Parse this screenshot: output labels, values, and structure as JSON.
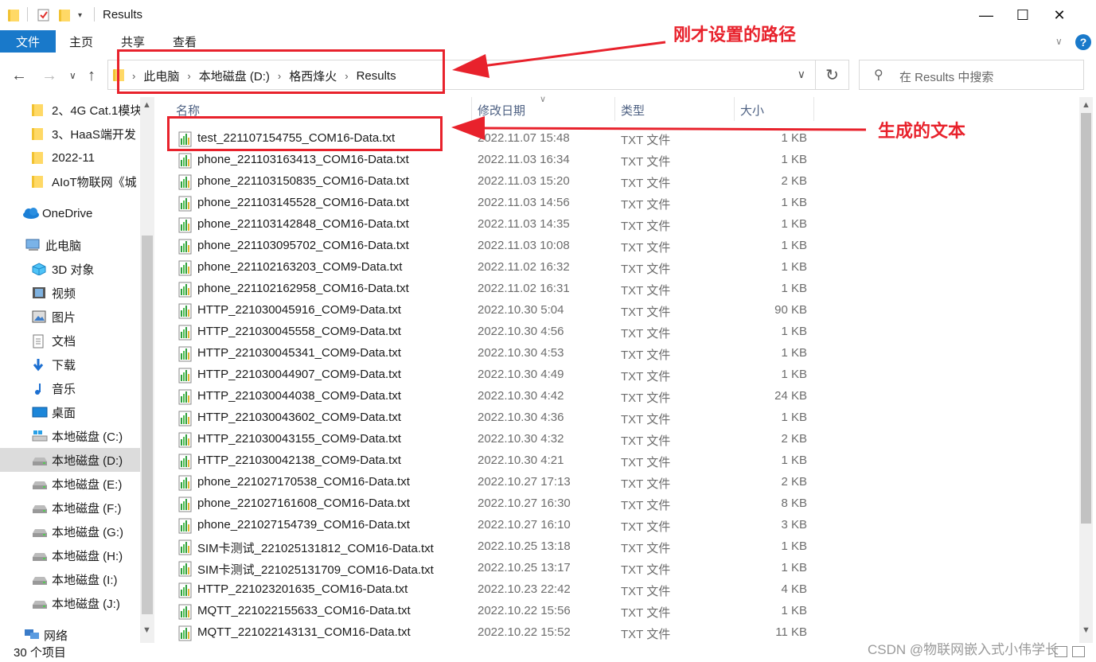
{
  "window": {
    "title": "Results",
    "min_glyph": "—",
    "max_glyph": "☐",
    "close_glyph": "✕"
  },
  "ribbon": {
    "tabs": [
      "文件",
      "主页",
      "共享",
      "查看"
    ],
    "help_glyph": "?",
    "collapse_glyph": "∨"
  },
  "address": {
    "crumbs": [
      "此电脑",
      "本地磁盘 (D:)",
      "格西烽火",
      "Results"
    ],
    "sep": "›",
    "dropdown_glyph": "∨",
    "refresh_glyph": "↻"
  },
  "search": {
    "placeholder": "在 Results 中搜索",
    "icon_glyph": "⚲"
  },
  "nav": {
    "back": "←",
    "forward": "→",
    "recent": "∨",
    "up": "↑"
  },
  "sidebar": {
    "items": [
      {
        "label": "2、4G Cat.1模块",
        "icon": "folder-icon"
      },
      {
        "label": "3、HaaS端开发",
        "icon": "folder-icon"
      },
      {
        "label": "2022-11",
        "icon": "folder-icon"
      },
      {
        "label": "AIoT物联网《城",
        "icon": "folder-icon"
      },
      {
        "label": "OneDrive",
        "icon": "cloud-icon"
      },
      {
        "label": "此电脑",
        "icon": "computer-icon"
      },
      {
        "label": "3D 对象",
        "icon": "cube-icon"
      },
      {
        "label": "视频",
        "icon": "video-icon"
      },
      {
        "label": "图片",
        "icon": "picture-icon"
      },
      {
        "label": "文档",
        "icon": "document-icon"
      },
      {
        "label": "下载",
        "icon": "download-icon"
      },
      {
        "label": "音乐",
        "icon": "music-icon"
      },
      {
        "label": "桌面",
        "icon": "desktop-icon"
      },
      {
        "label": "本地磁盘 (C:)",
        "icon": "windows-drive-icon"
      },
      {
        "label": "本地磁盘 (D:)",
        "icon": "drive-icon",
        "selected": true
      },
      {
        "label": "本地磁盘 (E:)",
        "icon": "drive-icon"
      },
      {
        "label": "本地磁盘 (F:)",
        "icon": "drive-icon"
      },
      {
        "label": "本地磁盘 (G:)",
        "icon": "drive-icon"
      },
      {
        "label": "本地磁盘 (H:)",
        "icon": "drive-icon"
      },
      {
        "label": "本地磁盘 (I:)",
        "icon": "drive-icon"
      },
      {
        "label": "本地磁盘 (J:)",
        "icon": "drive-icon"
      },
      {
        "label": "网络",
        "icon": "network-icon"
      }
    ]
  },
  "columns": {
    "name": "名称",
    "date": "修改日期",
    "type": "类型",
    "size": "大小",
    "sort_glyph": "∨"
  },
  "files": [
    {
      "name": "test_221107154755_COM16-Data.txt",
      "date": "2022.11.07 15:48",
      "type": "TXT 文件",
      "size": "1 KB"
    },
    {
      "name": "phone_221103163413_COM16-Data.txt",
      "date": "2022.11.03 16:34",
      "type": "TXT 文件",
      "size": "1 KB"
    },
    {
      "name": "phone_221103150835_COM16-Data.txt",
      "date": "2022.11.03 15:20",
      "type": "TXT 文件",
      "size": "2 KB"
    },
    {
      "name": "phone_221103145528_COM16-Data.txt",
      "date": "2022.11.03 14:56",
      "type": "TXT 文件",
      "size": "1 KB"
    },
    {
      "name": "phone_221103142848_COM16-Data.txt",
      "date": "2022.11.03 14:35",
      "type": "TXT 文件",
      "size": "1 KB"
    },
    {
      "name": "phone_221103095702_COM16-Data.txt",
      "date": "2022.11.03 10:08",
      "type": "TXT 文件",
      "size": "1 KB"
    },
    {
      "name": "phone_221102163203_COM9-Data.txt",
      "date": "2022.11.02 16:32",
      "type": "TXT 文件",
      "size": "1 KB"
    },
    {
      "name": "phone_221102162958_COM16-Data.txt",
      "date": "2022.11.02 16:31",
      "type": "TXT 文件",
      "size": "1 KB"
    },
    {
      "name": "HTTP_221030045916_COM9-Data.txt",
      "date": "2022.10.30 5:04",
      "type": "TXT 文件",
      "size": "90 KB"
    },
    {
      "name": "HTTP_221030045558_COM9-Data.txt",
      "date": "2022.10.30 4:56",
      "type": "TXT 文件",
      "size": "1 KB"
    },
    {
      "name": "HTTP_221030045341_COM9-Data.txt",
      "date": "2022.10.30 4:53",
      "type": "TXT 文件",
      "size": "1 KB"
    },
    {
      "name": "HTTP_221030044907_COM9-Data.txt",
      "date": "2022.10.30 4:49",
      "type": "TXT 文件",
      "size": "1 KB"
    },
    {
      "name": "HTTP_221030044038_COM9-Data.txt",
      "date": "2022.10.30 4:42",
      "type": "TXT 文件",
      "size": "24 KB"
    },
    {
      "name": "HTTP_221030043602_COM9-Data.txt",
      "date": "2022.10.30 4:36",
      "type": "TXT 文件",
      "size": "1 KB"
    },
    {
      "name": "HTTP_221030043155_COM9-Data.txt",
      "date": "2022.10.30 4:32",
      "type": "TXT 文件",
      "size": "2 KB"
    },
    {
      "name": "HTTP_221030042138_COM9-Data.txt",
      "date": "2022.10.30 4:21",
      "type": "TXT 文件",
      "size": "1 KB"
    },
    {
      "name": "phone_221027170538_COM16-Data.txt",
      "date": "2022.10.27 17:13",
      "type": "TXT 文件",
      "size": "2 KB"
    },
    {
      "name": "phone_221027161608_COM16-Data.txt",
      "date": "2022.10.27 16:30",
      "type": "TXT 文件",
      "size": "8 KB"
    },
    {
      "name": "phone_221027154739_COM16-Data.txt",
      "date": "2022.10.27 16:10",
      "type": "TXT 文件",
      "size": "3 KB"
    },
    {
      "name": "SIM卡测试_221025131812_COM16-Data.txt",
      "date": "2022.10.25 13:18",
      "type": "TXT 文件",
      "size": "1 KB"
    },
    {
      "name": "SIM卡测试_221025131709_COM16-Data.txt",
      "date": "2022.10.25 13:17",
      "type": "TXT 文件",
      "size": "1 KB"
    },
    {
      "name": "HTTP_221023201635_COM16-Data.txt",
      "date": "2022.10.23 22:42",
      "type": "TXT 文件",
      "size": "4 KB"
    },
    {
      "name": "MQTT_221022155633_COM16-Data.txt",
      "date": "2022.10.22 15:56",
      "type": "TXT 文件",
      "size": "1 KB"
    },
    {
      "name": "MQTT_221022143131_COM16-Data.txt",
      "date": "2022.10.22 15:52",
      "type": "TXT 文件",
      "size": "11 KB"
    }
  ],
  "status": {
    "count": "30 个项目"
  },
  "annotations": {
    "path_label": "刚才设置的路径",
    "file_label": "生成的文本",
    "color": "#e8222c"
  },
  "watermark": "CSDN @物联网嵌入式小伟学长"
}
